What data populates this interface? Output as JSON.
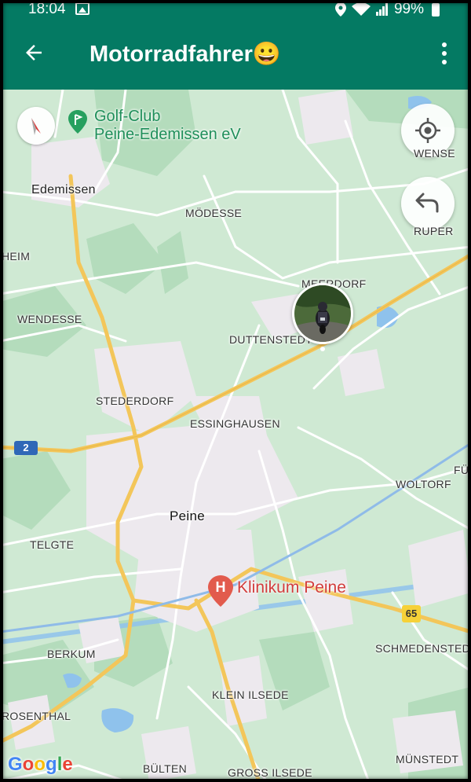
{
  "status_bar": {
    "time": "18:04",
    "battery": "99%"
  },
  "app_bar": {
    "title": "Motorradfahrer😀"
  },
  "map": {
    "poi": {
      "golf": [
        "Golf-Club",
        "Peine-Edemissen eV"
      ],
      "hospital": "Klinikum Peine"
    },
    "labels": {
      "edemissen": "Edemissen",
      "modesse": "MÖDESSE",
      "wense": "WENSE",
      "rupe": "RUPER",
      "heim": "HEIM",
      "meerdorf": "MEERDORF",
      "wendesse": "WENDESSE",
      "duttenstedt": "DUTTENSTEDT",
      "stederdorf": "STEDERDORF",
      "essinghausen": "ESSINGHAUSEN",
      "woltorf": "WOLTORF",
      "fur": "FÜR",
      "peine": "Peine",
      "telgte": "TELGTE",
      "schmedenstedt": "SCHMEDENSTEDT",
      "berkum": "BERKUM",
      "klein_ilsede": "KLEIN ILSEDE",
      "rosenthal": "ROSENTHAL",
      "bulten": "BÜLTEN",
      "gross_ilsede": "GROSS ILSEDE",
      "munstedt": "MÜNSTEDT"
    },
    "road_shields": {
      "a2": "2",
      "b65": "65"
    },
    "attribution": "Google"
  }
}
